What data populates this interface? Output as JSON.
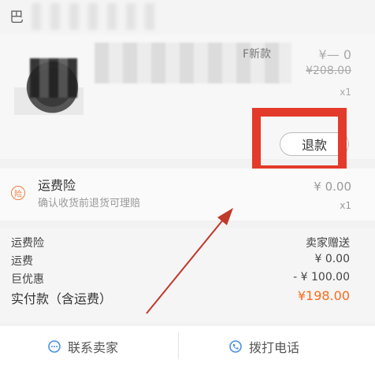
{
  "top": {
    "back_glyph": "巴"
  },
  "product": {
    "title_suffix": "F新款",
    "price": "¥— 0",
    "original_price": "¥208.00",
    "quantity": "x1"
  },
  "refund_button": {
    "label": "退款"
  },
  "insurance": {
    "badge": "险",
    "title": "运费险",
    "description": "确认收货前退货可理赔",
    "price": "¥ 0.00",
    "quantity": "x1"
  },
  "summary": {
    "rows": [
      {
        "label": "运费险",
        "value": "卖家赠送"
      },
      {
        "label": "运费",
        "value": "¥ 0.00"
      },
      {
        "label": "巨优惠",
        "value": "- ¥ 100.00"
      }
    ],
    "total_label": "实付款（含运费）",
    "total_value": "¥198.00"
  },
  "bottom_bar": {
    "contact_seller": "联系卖家",
    "call_phone": "拨打电话"
  },
  "colors": {
    "accent_orange": "#ff6a1a",
    "highlight_red": "#e33b2b",
    "arrow_red": "#c0392b",
    "insurance_badge": "#f47a3a"
  },
  "icons": [
    "back-icon",
    "insurance-badge-icon",
    "chat-icon",
    "phone-icon"
  ]
}
